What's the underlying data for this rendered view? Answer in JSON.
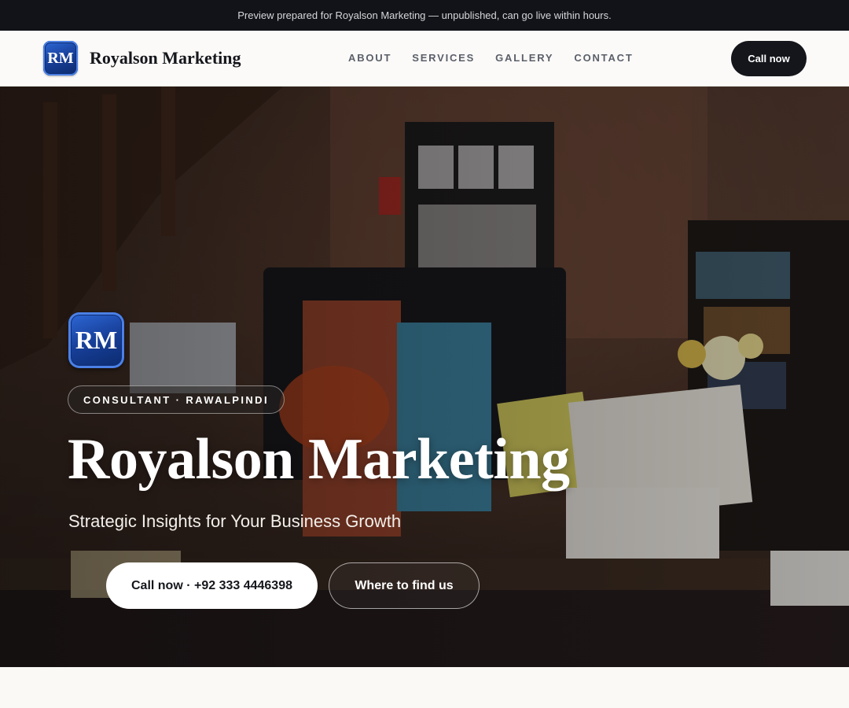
{
  "preview_bar": {
    "text": "Preview prepared for Royalson Marketing — unpublished, can go live within hours."
  },
  "header": {
    "logo_text": "RM",
    "brand_name": "Royalson Marketing",
    "nav": [
      {
        "label": "ABOUT"
      },
      {
        "label": "SERVICES"
      },
      {
        "label": "GALLERY"
      },
      {
        "label": "CONTACT"
      }
    ],
    "cta_label": "Call now"
  },
  "hero": {
    "logo_text": "RM",
    "tag": "CONSULTANT · RAWALPINDI",
    "title": "Royalson Marketing",
    "subtitle": "Strategic Insights for Your Business Growth",
    "primary_button": "Call now · +92 333 4446398",
    "secondary_button": "Where to find us"
  },
  "colors": {
    "dark": "#111318",
    "logo_blue": "#173f99",
    "page_bg": "#faf9f6"
  }
}
